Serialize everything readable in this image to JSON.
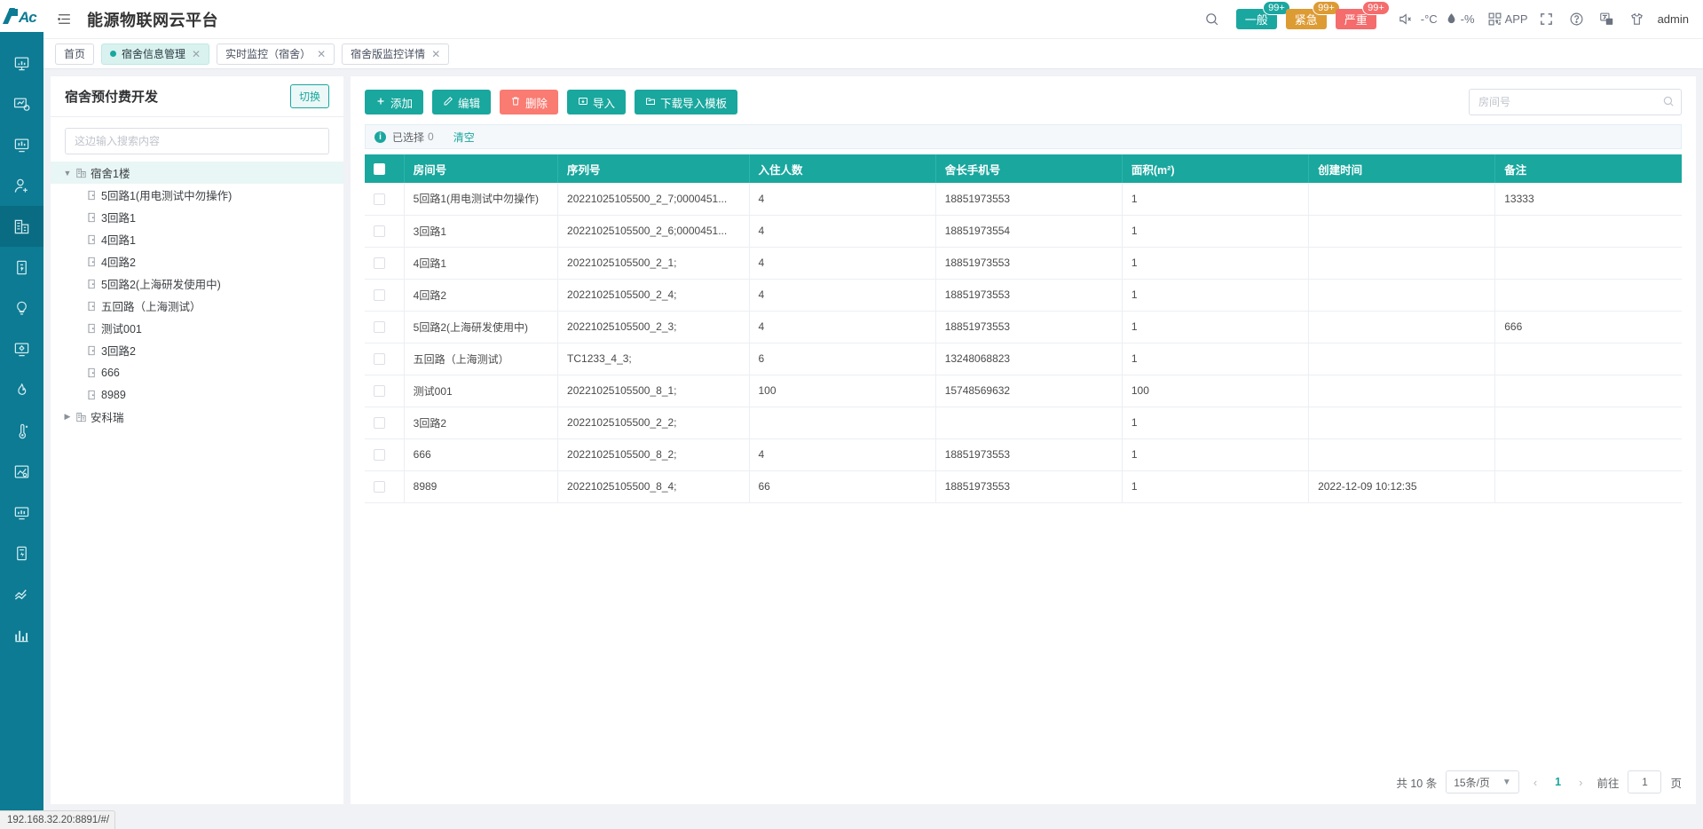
{
  "brand": {
    "logo_text": "Ac",
    "accent": "#19a79e",
    "rail_bg": "#0c7b93"
  },
  "header": {
    "title": "能源物联网云平台",
    "menu_icon": "hamburger-icon",
    "search_icon": "search-icon",
    "badges": [
      {
        "label": "一般",
        "count": "99+",
        "color": "#1aa7a0",
        "name": "alarm-normal"
      },
      {
        "label": "紧急",
        "count": "99+",
        "color": "#dd9b34",
        "name": "alarm-urgent"
      },
      {
        "label": "严重",
        "count": "99+",
        "color": "#f56c6c",
        "name": "alarm-severe"
      }
    ],
    "mute_icon": "mute-icon",
    "temperature": "-°C",
    "humidity": "-%",
    "app_label": "APP",
    "fullscreen_icon": "fullscreen-icon",
    "help_icon": "help-icon",
    "language_icon": "language-icon",
    "theme_icon": "shirt-icon",
    "username": "admin"
  },
  "tabs": [
    {
      "label": "首页",
      "active": false,
      "closable": false
    },
    {
      "label": "宿舍信息管理",
      "active": true,
      "closable": true
    },
    {
      "label": "实时监控（宿舍）",
      "active": false,
      "closable": true
    },
    {
      "label": "宿舍版监控详情",
      "active": false,
      "closable": true
    }
  ],
  "rail": {
    "items": [
      {
        "name": "sidebar-item-monitor",
        "icon": "monitor-icon",
        "active": false
      },
      {
        "name": "sidebar-item-analysis",
        "icon": "chart-monitor-icon",
        "active": false
      },
      {
        "name": "sidebar-item-report",
        "icon": "report-screen-icon",
        "active": false
      },
      {
        "name": "sidebar-item-user",
        "icon": "user-icon",
        "active": false
      },
      {
        "name": "sidebar-item-dorm",
        "icon": "building-list-icon",
        "active": true
      },
      {
        "name": "sidebar-item-device",
        "icon": "device-icon",
        "active": false
      },
      {
        "name": "sidebar-item-lamp",
        "icon": "bulb-icon",
        "active": false
      },
      {
        "name": "sidebar-item-settings",
        "icon": "gear-screen-icon",
        "active": false
      },
      {
        "name": "sidebar-item-fire",
        "icon": "flame-icon",
        "active": false
      },
      {
        "name": "sidebar-item-temperature",
        "icon": "thermometer-icon",
        "active": false
      },
      {
        "name": "sidebar-item-energy-chart",
        "icon": "image-chart-icon",
        "active": false
      },
      {
        "name": "sidebar-item-meter",
        "icon": "meter-screen-icon",
        "active": false
      },
      {
        "name": "sidebar-item-battery",
        "icon": "battery-icon",
        "active": false
      },
      {
        "name": "sidebar-item-trend",
        "icon": "trend-icon",
        "active": false
      },
      {
        "name": "sidebar-item-statistics",
        "icon": "bar-chart-icon",
        "active": false
      }
    ]
  },
  "tree_panel": {
    "title": "宿舍预付费开发",
    "switch_label": "切换",
    "search_placeholder": "这边输入搜索内容",
    "search_value": "",
    "nodes": [
      {
        "label": "宿舍1楼",
        "level": 0,
        "expanded": true,
        "selected": true
      },
      {
        "label": "5回路1(用电测试中勿操作)",
        "level": 1,
        "expanded": false,
        "selected": false
      },
      {
        "label": "3回路1",
        "level": 1,
        "expanded": false,
        "selected": false
      },
      {
        "label": "4回路1",
        "level": 1,
        "expanded": false,
        "selected": false
      },
      {
        "label": "4回路2",
        "level": 1,
        "expanded": false,
        "selected": false
      },
      {
        "label": "5回路2(上海研发使用中)",
        "level": 1,
        "expanded": false,
        "selected": false
      },
      {
        "label": "五回路（上海测试）",
        "level": 1,
        "expanded": false,
        "selected": false
      },
      {
        "label": "测试001",
        "level": 1,
        "expanded": false,
        "selected": false
      },
      {
        "label": "3回路2",
        "level": 1,
        "expanded": false,
        "selected": false
      },
      {
        "label": "666",
        "level": 1,
        "expanded": false,
        "selected": false
      },
      {
        "label": "8989",
        "level": 1,
        "expanded": false,
        "selected": false
      },
      {
        "label": "安科瑞",
        "level": 0,
        "expanded": false,
        "selected": false
      }
    ]
  },
  "toolbar": {
    "add_label": "添加",
    "edit_label": "编辑",
    "delete_label": "删除",
    "import_label": "导入",
    "template_label": "下载导入模板",
    "search_placeholder": "房间号",
    "search_value": ""
  },
  "selection_bar": {
    "text": "已选择",
    "count": "0",
    "clear_label": "清空"
  },
  "table": {
    "columns": [
      "房间号",
      "序列号",
      "入住人数",
      "舍长手机号",
      "面积(m²)",
      "创建时间",
      "备注"
    ],
    "rows": [
      {
        "room": "5回路1(用电测试中勿操作)",
        "serial": "20221025105500_2_7;0000451...",
        "people": "4",
        "phone": "18851973553",
        "area": "1",
        "created": "",
        "remark": "13333"
      },
      {
        "room": "3回路1",
        "serial": "20221025105500_2_6;0000451...",
        "people": "4",
        "phone": "18851973554",
        "area": "1",
        "created": "",
        "remark": ""
      },
      {
        "room": "4回路1",
        "serial": "20221025105500_2_1;",
        "people": "4",
        "phone": "18851973553",
        "area": "1",
        "created": "",
        "remark": ""
      },
      {
        "room": "4回路2",
        "serial": "20221025105500_2_4;",
        "people": "4",
        "phone": "18851973553",
        "area": "1",
        "created": "",
        "remark": ""
      },
      {
        "room": "5回路2(上海研发使用中)",
        "serial": "20221025105500_2_3;",
        "people": "4",
        "phone": "18851973553",
        "area": "1",
        "created": "",
        "remark": "666"
      },
      {
        "room": "五回路（上海测试）",
        "serial": "TC1233_4_3;",
        "people": "6",
        "phone": "13248068823",
        "area": "1",
        "created": "",
        "remark": ""
      },
      {
        "room": "测试001",
        "serial": "20221025105500_8_1;",
        "people": "100",
        "phone": "15748569632",
        "area": "100",
        "created": "",
        "remark": ""
      },
      {
        "room": "3回路2",
        "serial": "20221025105500_2_2;",
        "people": "",
        "phone": "",
        "area": "1",
        "created": "",
        "remark": ""
      },
      {
        "room": "666",
        "serial": "20221025105500_8_2;",
        "people": "4",
        "phone": "18851973553",
        "area": "1",
        "created": "",
        "remark": ""
      },
      {
        "room": "8989",
        "serial": "20221025105500_8_4;",
        "people": "66",
        "phone": "18851973553",
        "area": "1",
        "created": "2022-12-09 10:12:35",
        "remark": ""
      }
    ]
  },
  "pagination": {
    "total_label": "共 10 条",
    "page_size": "15条/页",
    "prev_icon": "chevron-left-icon",
    "next_icon": "chevron-right-icon",
    "current_page": "1",
    "goto_label": "前往",
    "goto_value": "1",
    "page_unit": "页"
  },
  "status_bar": {
    "url": "192.168.32.20:8891/#/"
  }
}
